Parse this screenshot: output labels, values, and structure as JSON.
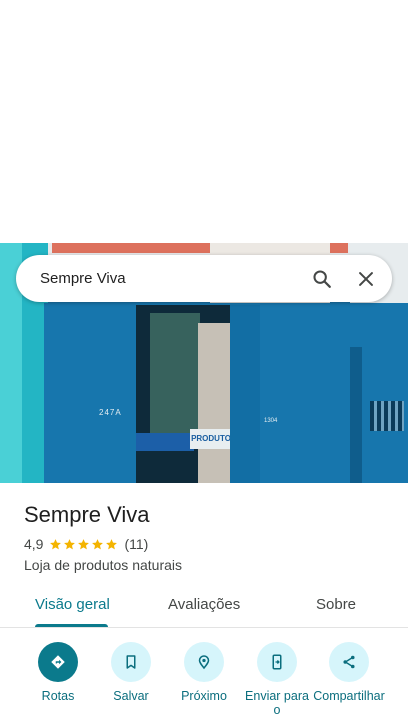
{
  "search": {
    "query": "Sempre Viva",
    "search_icon": "search-icon",
    "clear_icon": "close-icon"
  },
  "photo": {
    "number_left": "247A",
    "number_right": "1304",
    "sign_text": "PRODUTO"
  },
  "place": {
    "name": "Sempre Viva",
    "rating": "4,9",
    "stars": 5,
    "review_count": "(11)",
    "category": "Loja de produtos naturais"
  },
  "tabs": [
    {
      "label": "Visão geral",
      "active": true
    },
    {
      "label": "Avaliações",
      "active": false
    },
    {
      "label": "Sobre",
      "active": false
    }
  ],
  "actions": [
    {
      "label": "Rotas",
      "icon": "directions-icon"
    },
    {
      "label": "Salvar",
      "icon": "bookmark-icon"
    },
    {
      "label": "Próximo",
      "icon": "nearby-icon"
    },
    {
      "label": "Enviar para o",
      "icon": "send-to-phone-icon"
    },
    {
      "label": "Compartilhar",
      "icon": "share-icon"
    }
  ],
  "colors": {
    "accent": "#0b7a8c",
    "action_bg": "#d6f5fb",
    "star": "#f4b400"
  }
}
